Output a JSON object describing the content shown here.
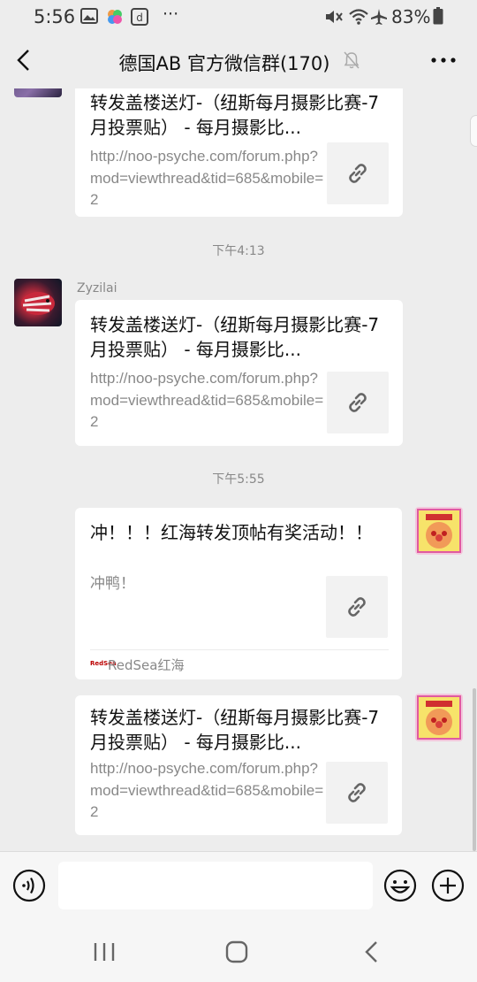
{
  "status_bar": {
    "time": "5:56",
    "more_indicator": "···",
    "battery_percent": "83%",
    "icons": [
      "image-icon",
      "app-icon",
      "d-app-icon",
      "mute-icon",
      "wifi-icon",
      "airplane-icon",
      "battery-icon"
    ]
  },
  "header": {
    "title": "德国AB  官方微信群(170)",
    "back_icon": "back-icon",
    "mute_icon": "bell-off-icon",
    "more_icon": "more-icon"
  },
  "messages": [
    {
      "type": "link-card",
      "side": "left",
      "title": "转发盖楼送灯-（纽斯每月摄影比赛-7月投票贴） - 每月摄影比...",
      "description": "http://noo-psyche.com/forum.php?mod=viewthread&tid=685&mobile=2",
      "thumb_icon": "link-icon"
    },
    {
      "type": "timestamp",
      "text": "下午4:13"
    },
    {
      "type": "link-card",
      "side": "left",
      "sender": "Zyzilai",
      "title": "转发盖楼送灯-（纽斯每月摄影比赛-7月投票贴） - 每月摄影比...",
      "description": "http://noo-psyche.com/forum.php?mod=viewthread&tid=685&mobile=2",
      "thumb_icon": "link-icon"
    },
    {
      "type": "timestamp",
      "text": "下午5:55"
    },
    {
      "type": "link-card",
      "side": "right",
      "title": "冲！！！红海转发顶帖有奖活动！！",
      "description": "冲鸭！",
      "source": "RedSea红海",
      "source_logo": "RedSea",
      "thumb_icon": "link-icon"
    },
    {
      "type": "link-card",
      "side": "right",
      "title": "转发盖楼送灯-（纽斯每月摄影比赛-7月投票贴） - 每月摄影比...",
      "description": "http://noo-psyche.com/forum.php?mod=viewthread&tid=685&mobile=2",
      "thumb_icon": "link-icon"
    }
  ],
  "input_bar": {
    "value": "",
    "placeholder": "",
    "voice_icon": "voice-icon",
    "emoji_icon": "emoji-icon",
    "plus_icon": "plus-icon"
  },
  "nav_bar": {
    "icons": [
      "recents-icon",
      "home-icon",
      "back-nav-icon"
    ]
  },
  "colors": {
    "background": "#ededed",
    "bubble": "#ffffff",
    "secondary_text": "#888888"
  }
}
